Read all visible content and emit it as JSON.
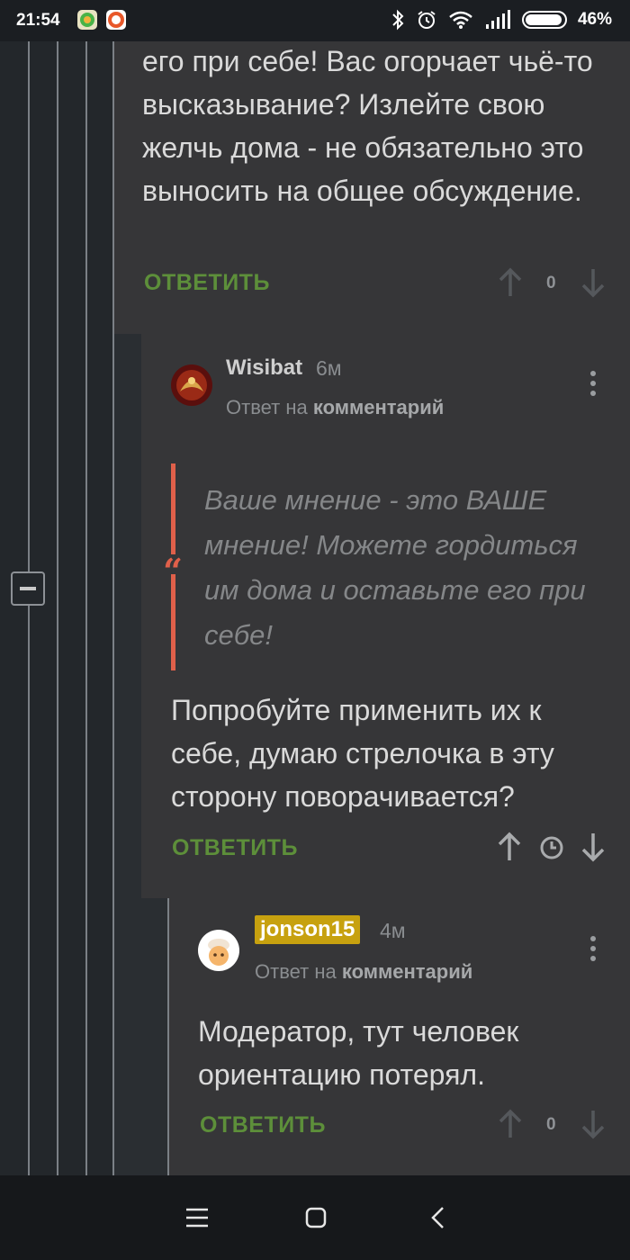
{
  "status_bar": {
    "time": "21:54",
    "battery_percent": "46%",
    "battery_level": 0.46
  },
  "comments": [
    {
      "body_tail": "его при себе! Вас огорчает чьё-то высказывание? Излейте свою желчь дома - не обязательно это выносить на общее обсуждение.",
      "reply_label": "ОТВЕТИТЬ",
      "score": "0"
    },
    {
      "username": "Wisibat",
      "time_ago": "6м",
      "reply_prefix": "Ответ на",
      "reply_link": "комментарий",
      "quote": "Ваше мнение - это ВАШЕ мнение! Можете гордиться им дома и оставьте его при себе!",
      "quote_mark": "“",
      "body": "Попробуйте применить их к себе, думаю стрелочка в эту сторону поворачивается?",
      "reply_label": "ОТВЕТИТЬ"
    },
    {
      "username": "jonson15",
      "time_ago": "4м",
      "reply_prefix": "Ответ на",
      "reply_link": "комментарий",
      "body": "Модератор, тут человек ориентацию потерял.",
      "reply_label": "ОТВЕТИТЬ",
      "score": "0"
    }
  ],
  "icons": {
    "app1": "green-app-icon",
    "app2": "orange-app-icon",
    "bluetooth": "bluetooth-icon",
    "alarm": "alarm-icon",
    "wifi": "wifi-icon",
    "signal": "signal-icon",
    "upvote": "arrow-up-icon",
    "downvote": "arrow-down-icon",
    "pending": "clock-icon",
    "more": "more-vertical-icon",
    "collapse": "minus-icon",
    "menu": "menu-icon",
    "home": "home-icon",
    "back": "back-icon"
  },
  "colors": {
    "accent_green": "#5d8f3a",
    "quote_red": "#e0604a",
    "badge_yellow": "#c7a10f",
    "panel": "#363638"
  }
}
